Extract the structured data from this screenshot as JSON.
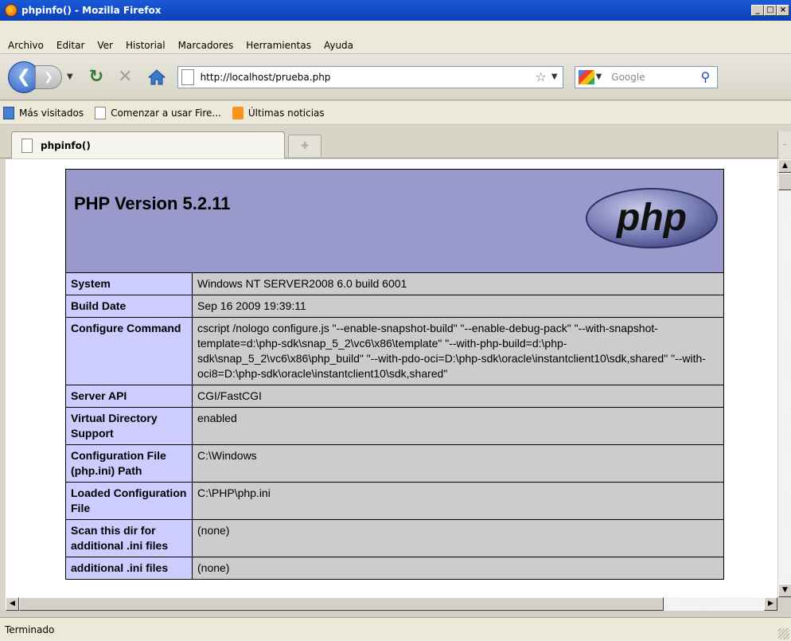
{
  "window": {
    "title": "phpinfo() - Mozilla Firefox",
    "controls": [
      "_",
      "□",
      "×"
    ]
  },
  "menu": [
    "Archivo",
    "Editar",
    "Ver",
    "Historial",
    "Marcadores",
    "Herramientas",
    "Ayuda"
  ],
  "navbar": {
    "url": "http://localhost/prueba.php",
    "search_placeholder": "Google"
  },
  "bookmarks": [
    {
      "label": "Más visitados",
      "icon": "most-visited-icon"
    },
    {
      "label": "Comenzar a usar Fire...",
      "icon": "page-icon"
    },
    {
      "label": "Últimas noticias",
      "icon": "rss-icon"
    }
  ],
  "tabs": [
    {
      "label": "phpinfo()"
    }
  ],
  "page": {
    "heading": "PHP Version 5.2.11",
    "logo_text": "php",
    "rows": [
      {
        "key": "System",
        "value": "Windows NT SERVER2008 6.0 build 6001"
      },
      {
        "key": "Build Date",
        "value": "Sep 16 2009 19:39:11"
      },
      {
        "key": "Configure Command",
        "value": "cscript /nologo configure.js \"--enable-snapshot-build\" \"--enable-debug-pack\" \"--with-snapshot-template=d:\\php-sdk\\snap_5_2\\vc6\\x86\\template\" \"--with-php-build=d:\\php-sdk\\snap_5_2\\vc6\\x86\\php_build\" \"--with-pdo-oci=D:\\php-sdk\\oracle\\instantclient10\\sdk,shared\" \"--with-oci8=D:\\php-sdk\\oracle\\instantclient10\\sdk,shared\""
      },
      {
        "key": "Server API",
        "value": "CGI/FastCGI"
      },
      {
        "key": "Virtual Directory Support",
        "value": "enabled"
      },
      {
        "key": "Configuration File (php.ini) Path",
        "value": "C:\\Windows"
      },
      {
        "key": "Loaded Configuration File",
        "value": "C:\\PHP\\php.ini"
      },
      {
        "key": "Scan this dir for additional .ini files",
        "value": "(none)"
      },
      {
        "key": "additional .ini files",
        "value": "(none)"
      }
    ]
  },
  "status": {
    "text": "Terminado"
  },
  "colors": {
    "header_bg": "#9999cc",
    "key_bg": "#ccccff",
    "value_bg": "#cccccc"
  }
}
